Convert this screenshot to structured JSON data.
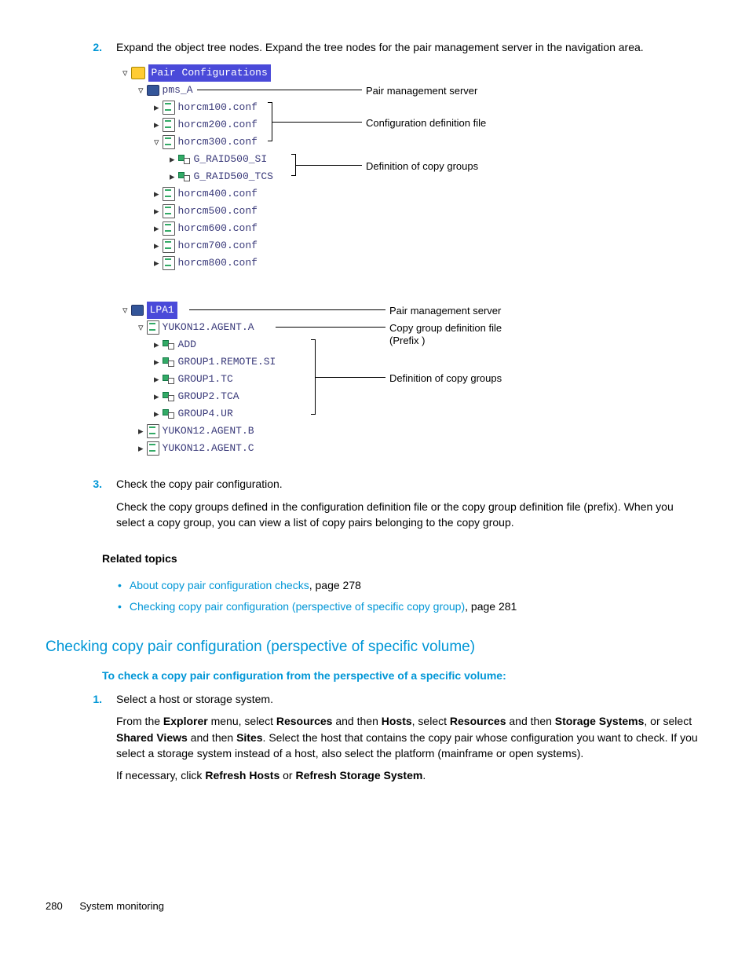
{
  "steps": {
    "s2": {
      "num": "2.",
      "text": "Expand the object tree nodes. Expand the tree nodes for the pair management server in the navigation area."
    },
    "s3": {
      "num": "3.",
      "line1": "Check the copy pair configuration.",
      "line2": "Check the copy groups defined in the configuration definition file or the copy group definition file (prefix). When you select a copy group, you can view a list of copy pairs belonging to the copy group."
    },
    "s1b": {
      "num": "1.",
      "line1": "Select a host or storage system.",
      "l2a": "From the ",
      "l2b": " menu, select ",
      "l2c": " and then ",
      "l2d": ", select ",
      "l2e": " and then ",
      "l2f": ", or select ",
      "l2g": " and then ",
      "l2h": ". Select the host that contains the copy pair whose configuration you want to check. If you select a storage system instead of a host, also select the platform (mainframe or open systems).",
      "l3a": "If necessary, click ",
      "l3b": " or ",
      "l3c": "."
    }
  },
  "bold": {
    "explorer": "Explorer",
    "resources": "Resources",
    "hosts": "Hosts",
    "storage": "Storage Systems",
    "shared": "Shared Views",
    "sites": "Sites",
    "refreshHosts": "Refresh Hosts",
    "refreshStorage": "Refresh Storage System"
  },
  "tree": {
    "root": "Pair Configurations",
    "pms": "pms_A",
    "h100": "horcm100.conf",
    "h200": "horcm200.conf",
    "h300": "horcm300.conf",
    "g1": "G_RAID500_SI",
    "g2": "G_RAID500_TCS",
    "h400": "horcm400.conf",
    "h500": "horcm500.conf",
    "h600": "horcm600.conf",
    "h700": "horcm700.conf",
    "h800": "horcm800.conf",
    "lpa": "LPA1",
    "ya": "YUKON12.AGENT.A",
    "yb": "YUKON12.AGENT.B",
    "yc": "YUKON12.AGENT.C",
    "add": "ADD",
    "gr1": "GROUP1.REMOTE.SI",
    "gr2": "GROUP1.TC",
    "gr3": "GROUP2.TCA",
    "gr4": "GROUP4.UR"
  },
  "ann": {
    "pms": "Pair management server",
    "cfg": "Configuration definition file",
    "defgrp": "Definition of copy groups",
    "cgf": "Copy group definition file",
    "prefix": "(Prefix )"
  },
  "related": {
    "heading": "Related topics",
    "a": "About copy pair configuration checks",
    "ap": ", page 278",
    "b": "Checking copy pair configuration (perspective of specific copy group)",
    "bp": ", page 281"
  },
  "section": {
    "title": "Checking copy pair configuration (perspective of specific volume)",
    "sub": "To check a copy pair configuration from the perspective of a specific volume:"
  },
  "footer": {
    "page": "280",
    "chapter": "System monitoring"
  }
}
